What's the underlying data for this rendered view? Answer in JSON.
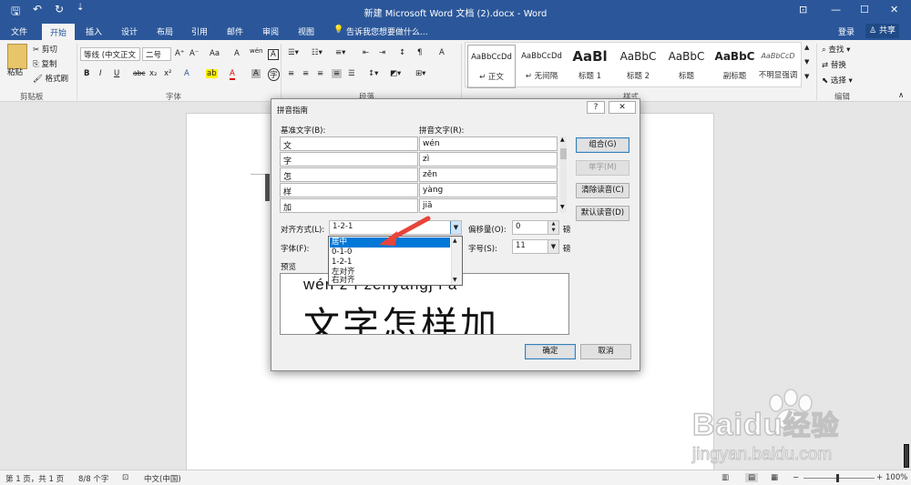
{
  "titlebar": {
    "title": "新建 Microsoft Word 文档 (2).docx - Word",
    "qat": {
      "save": "🖫",
      "undo": "↶",
      "redo": "↻",
      "custom": "⇣"
    },
    "controls": {
      "ribbon_display": "⊡",
      "minimize": "—",
      "maximize": "☐",
      "close": "✕"
    }
  },
  "tabs": [
    "文件",
    "开始",
    "插入",
    "设计",
    "布局",
    "引用",
    "邮件",
    "审阅",
    "视图"
  ],
  "tell_me": "告诉我您想要做什么...",
  "account": {
    "signin": "登录",
    "share": "共享"
  },
  "ribbon": {
    "clipboard": {
      "paste": "粘贴",
      "cut": "剪切",
      "copy": "复制",
      "format_painter": "格式刷",
      "label": "剪贴板"
    },
    "font": {
      "font_name": "等线 (中文正文",
      "font_size": "二号",
      "grow": "A⁺",
      "shrink": "A⁻",
      "case": "Aa",
      "clear": "A",
      "phonetic": "wén",
      "border_char": "A",
      "bold": "B",
      "italic": "I",
      "underline": "U",
      "strike": "abc",
      "subscript": "x₂",
      "superscript": "x²",
      "text_effect": "A",
      "highlight": "ab",
      "font_color": "A",
      "shading": "A",
      "enclose": "字",
      "label": "字体"
    },
    "paragraph": {
      "label": "段落"
    },
    "styles": {
      "label": "样式",
      "items": [
        {
          "preview": "AaBbCcDd",
          "name": "↵ 正文"
        },
        {
          "preview": "AaBbCcDd",
          "name": "↵ 无间隔"
        },
        {
          "preview": "AaBl",
          "name": "标题 1"
        },
        {
          "preview": "AaBbC",
          "name": "标题 2"
        },
        {
          "preview": "AaBbC",
          "name": "标题"
        },
        {
          "preview": "AaBbC",
          "name": "副标题"
        },
        {
          "preview": "AaBbCcD",
          "name": "不明显强调"
        }
      ]
    },
    "editing": {
      "find": "查找",
      "replace": "替换",
      "select": "选择",
      "label": "编辑"
    }
  },
  "dialog": {
    "title": "拼音指南",
    "help": "?",
    "close": "✕",
    "base_label": "基准文字(B):",
    "ruby_label": "拼音文字(R):",
    "rows": [
      {
        "base": "文",
        "ruby": "wén"
      },
      {
        "base": "字",
        "ruby": "zì"
      },
      {
        "base": "怎",
        "ruby": "zěn"
      },
      {
        "base": "样",
        "ruby": "yàng"
      },
      {
        "base": "加",
        "ruby": "jiā"
      }
    ],
    "buttons": {
      "group": "组合(G)",
      "mono": "单字(M)",
      "clear": "清除读音(C)",
      "default": "默认读音(D)",
      "ok": "确定",
      "cancel": "取消"
    },
    "align_label": "对齐方式(L):",
    "align_value": "1-2-1",
    "offset_label": "偏移量(O):",
    "offset_value": "0",
    "offset_unit": "磅",
    "font_label": "字体(F):",
    "size_label": "字号(S):",
    "size_value": "11",
    "size_unit": "磅",
    "preview_label": "预览",
    "preview_ruby": "wén z ì zěnyàngj i ā",
    "preview_text": "文字怎样加",
    "dropdown_options": [
      "居中",
      "0-1-0",
      "1-2-1",
      "左对齐",
      "右对齐"
    ],
    "dropdown_selected_index": 0
  },
  "status": {
    "page": "第 1 页，共 1 页",
    "words": "8/8 个字",
    "lang": "中文(中国)",
    "zoom": "100%",
    "zoom_minus": "−",
    "zoom_plus": "+"
  },
  "watermark": {
    "brand": "Baidu",
    "brand_cn": "经验",
    "url": "jingyan.baidu.com"
  },
  "colors": {
    "accent": "#2b579a",
    "select": "#0078d7",
    "arrow": "#e8443a"
  }
}
